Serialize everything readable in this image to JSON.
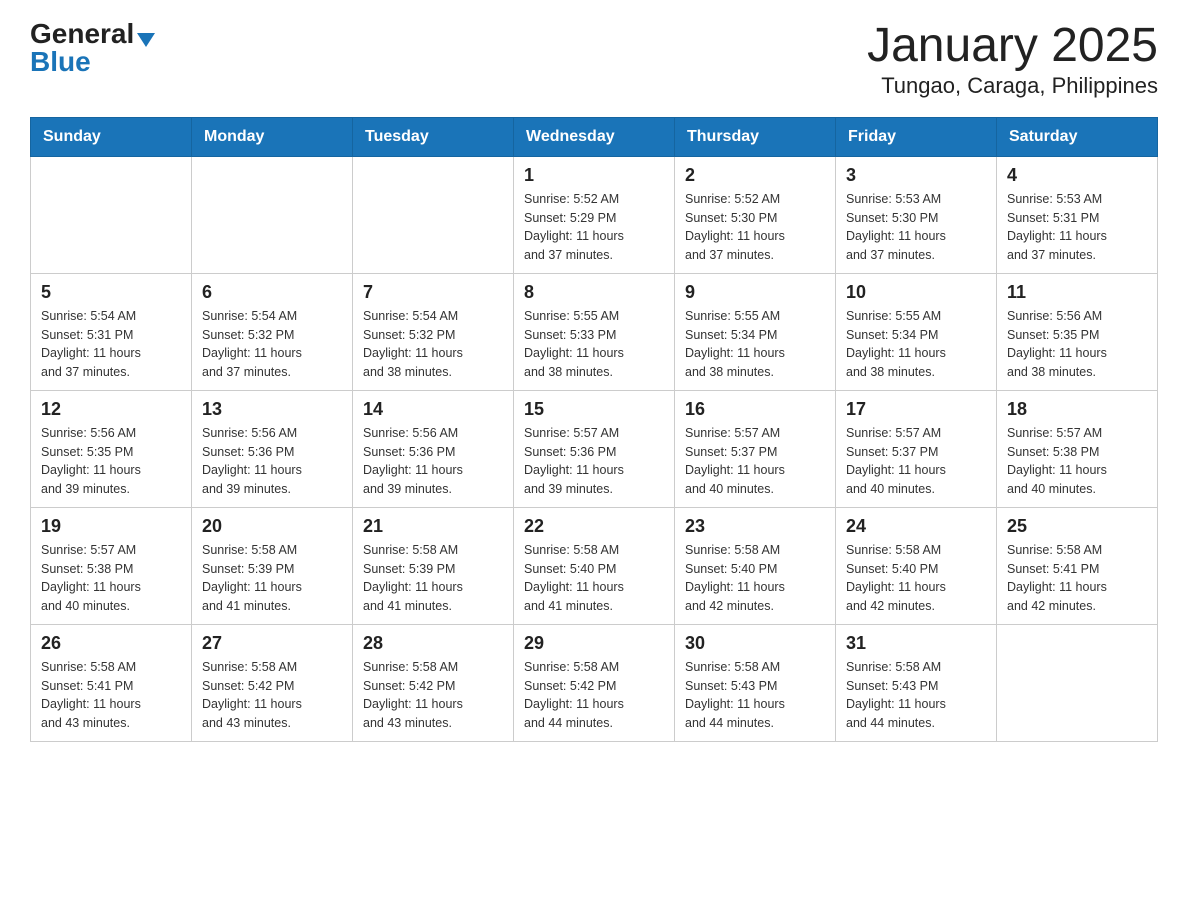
{
  "logo": {
    "general": "General",
    "blue": "Blue",
    "triangle": "▶"
  },
  "title": "January 2025",
  "subtitle": "Tungao, Caraga, Philippines",
  "headers": [
    "Sunday",
    "Monday",
    "Tuesday",
    "Wednesday",
    "Thursday",
    "Friday",
    "Saturday"
  ],
  "weeks": [
    [
      {
        "day": "",
        "info": ""
      },
      {
        "day": "",
        "info": ""
      },
      {
        "day": "",
        "info": ""
      },
      {
        "day": "1",
        "info": "Sunrise: 5:52 AM\nSunset: 5:29 PM\nDaylight: 11 hours\nand 37 minutes."
      },
      {
        "day": "2",
        "info": "Sunrise: 5:52 AM\nSunset: 5:30 PM\nDaylight: 11 hours\nand 37 minutes."
      },
      {
        "day": "3",
        "info": "Sunrise: 5:53 AM\nSunset: 5:30 PM\nDaylight: 11 hours\nand 37 minutes."
      },
      {
        "day": "4",
        "info": "Sunrise: 5:53 AM\nSunset: 5:31 PM\nDaylight: 11 hours\nand 37 minutes."
      }
    ],
    [
      {
        "day": "5",
        "info": "Sunrise: 5:54 AM\nSunset: 5:31 PM\nDaylight: 11 hours\nand 37 minutes."
      },
      {
        "day": "6",
        "info": "Sunrise: 5:54 AM\nSunset: 5:32 PM\nDaylight: 11 hours\nand 37 minutes."
      },
      {
        "day": "7",
        "info": "Sunrise: 5:54 AM\nSunset: 5:32 PM\nDaylight: 11 hours\nand 38 minutes."
      },
      {
        "day": "8",
        "info": "Sunrise: 5:55 AM\nSunset: 5:33 PM\nDaylight: 11 hours\nand 38 minutes."
      },
      {
        "day": "9",
        "info": "Sunrise: 5:55 AM\nSunset: 5:34 PM\nDaylight: 11 hours\nand 38 minutes."
      },
      {
        "day": "10",
        "info": "Sunrise: 5:55 AM\nSunset: 5:34 PM\nDaylight: 11 hours\nand 38 minutes."
      },
      {
        "day": "11",
        "info": "Sunrise: 5:56 AM\nSunset: 5:35 PM\nDaylight: 11 hours\nand 38 minutes."
      }
    ],
    [
      {
        "day": "12",
        "info": "Sunrise: 5:56 AM\nSunset: 5:35 PM\nDaylight: 11 hours\nand 39 minutes."
      },
      {
        "day": "13",
        "info": "Sunrise: 5:56 AM\nSunset: 5:36 PM\nDaylight: 11 hours\nand 39 minutes."
      },
      {
        "day": "14",
        "info": "Sunrise: 5:56 AM\nSunset: 5:36 PM\nDaylight: 11 hours\nand 39 minutes."
      },
      {
        "day": "15",
        "info": "Sunrise: 5:57 AM\nSunset: 5:36 PM\nDaylight: 11 hours\nand 39 minutes."
      },
      {
        "day": "16",
        "info": "Sunrise: 5:57 AM\nSunset: 5:37 PM\nDaylight: 11 hours\nand 40 minutes."
      },
      {
        "day": "17",
        "info": "Sunrise: 5:57 AM\nSunset: 5:37 PM\nDaylight: 11 hours\nand 40 minutes."
      },
      {
        "day": "18",
        "info": "Sunrise: 5:57 AM\nSunset: 5:38 PM\nDaylight: 11 hours\nand 40 minutes."
      }
    ],
    [
      {
        "day": "19",
        "info": "Sunrise: 5:57 AM\nSunset: 5:38 PM\nDaylight: 11 hours\nand 40 minutes."
      },
      {
        "day": "20",
        "info": "Sunrise: 5:58 AM\nSunset: 5:39 PM\nDaylight: 11 hours\nand 41 minutes."
      },
      {
        "day": "21",
        "info": "Sunrise: 5:58 AM\nSunset: 5:39 PM\nDaylight: 11 hours\nand 41 minutes."
      },
      {
        "day": "22",
        "info": "Sunrise: 5:58 AM\nSunset: 5:40 PM\nDaylight: 11 hours\nand 41 minutes."
      },
      {
        "day": "23",
        "info": "Sunrise: 5:58 AM\nSunset: 5:40 PM\nDaylight: 11 hours\nand 42 minutes."
      },
      {
        "day": "24",
        "info": "Sunrise: 5:58 AM\nSunset: 5:40 PM\nDaylight: 11 hours\nand 42 minutes."
      },
      {
        "day": "25",
        "info": "Sunrise: 5:58 AM\nSunset: 5:41 PM\nDaylight: 11 hours\nand 42 minutes."
      }
    ],
    [
      {
        "day": "26",
        "info": "Sunrise: 5:58 AM\nSunset: 5:41 PM\nDaylight: 11 hours\nand 43 minutes."
      },
      {
        "day": "27",
        "info": "Sunrise: 5:58 AM\nSunset: 5:42 PM\nDaylight: 11 hours\nand 43 minutes."
      },
      {
        "day": "28",
        "info": "Sunrise: 5:58 AM\nSunset: 5:42 PM\nDaylight: 11 hours\nand 43 minutes."
      },
      {
        "day": "29",
        "info": "Sunrise: 5:58 AM\nSunset: 5:42 PM\nDaylight: 11 hours\nand 44 minutes."
      },
      {
        "day": "30",
        "info": "Sunrise: 5:58 AM\nSunset: 5:43 PM\nDaylight: 11 hours\nand 44 minutes."
      },
      {
        "day": "31",
        "info": "Sunrise: 5:58 AM\nSunset: 5:43 PM\nDaylight: 11 hours\nand 44 minutes."
      },
      {
        "day": "",
        "info": ""
      }
    ]
  ]
}
